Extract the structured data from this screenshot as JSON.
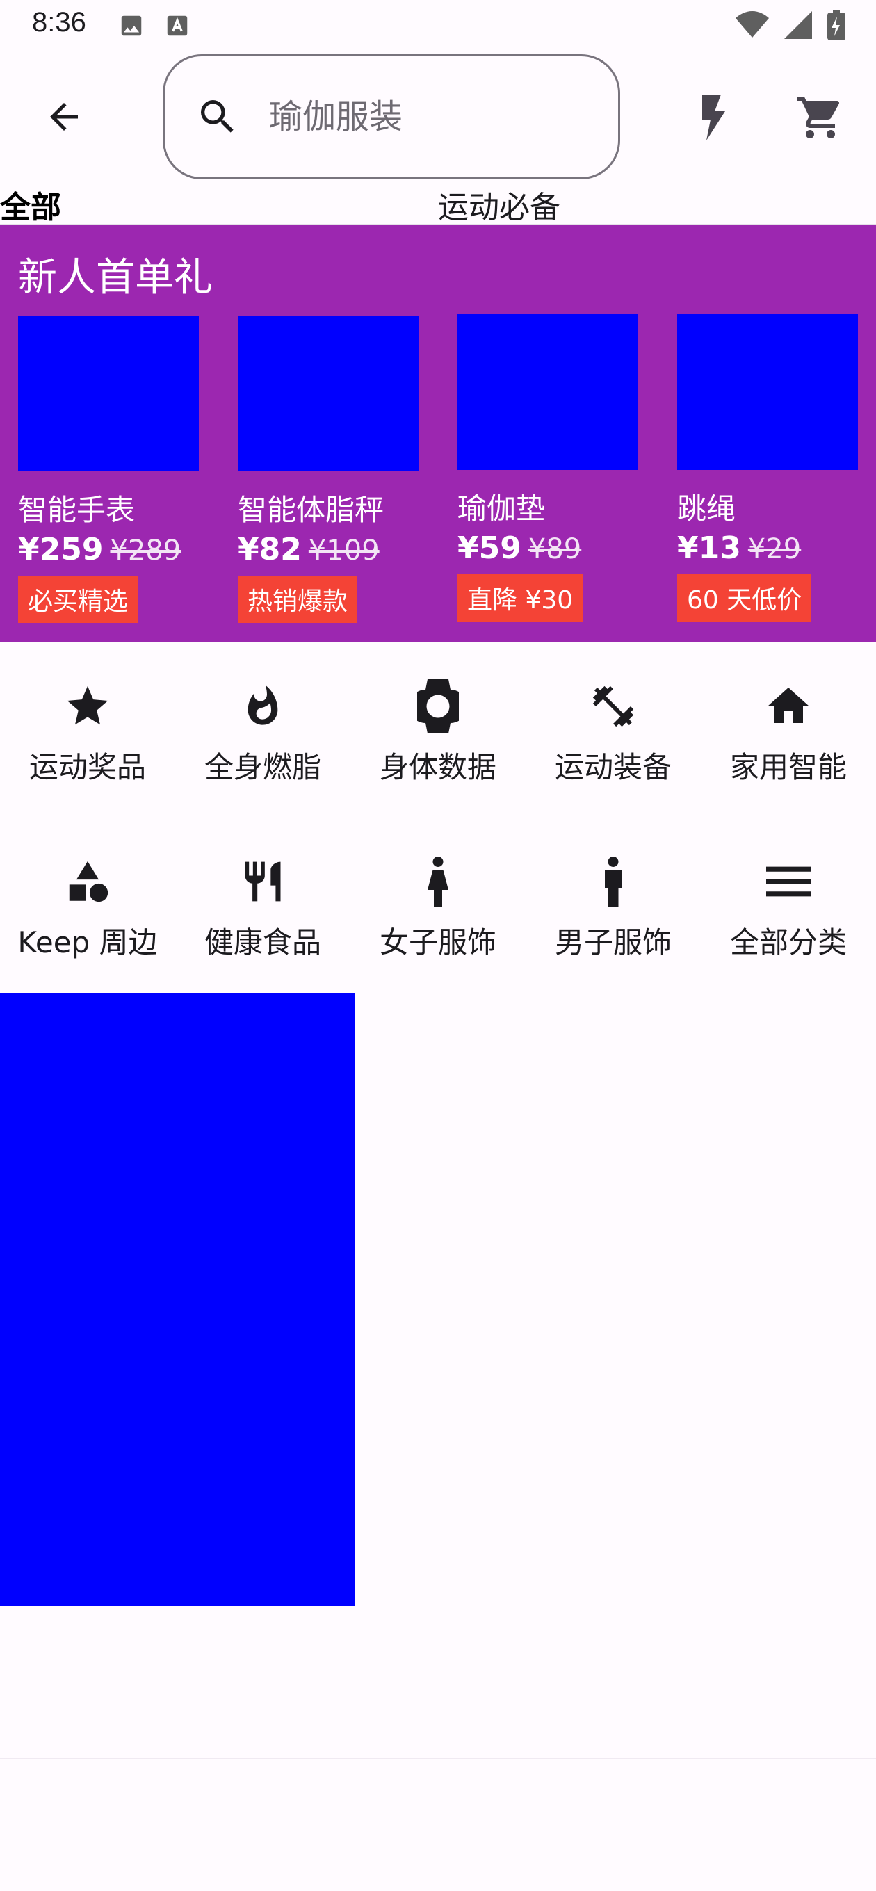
{
  "status_bar": {
    "time": "8:36"
  },
  "search": {
    "placeholder": "瑜伽服装"
  },
  "tabs": [
    {
      "label": "全部"
    },
    {
      "label": "运动必备"
    }
  ],
  "promo": {
    "title": "新人首单礼",
    "background": "#9C27B0",
    "products": [
      {
        "name": "智能手表",
        "price": "¥259",
        "original_price": "¥289",
        "tag": "必买精选"
      },
      {
        "name": "智能体脂秤",
        "price": "¥82",
        "original_price": "¥109",
        "tag": "热销爆款"
      },
      {
        "name": "瑜伽垫",
        "price": "¥59",
        "original_price": "¥89",
        "tag": "直降 ¥30"
      },
      {
        "name": "跳绳",
        "price": "¥13",
        "original_price": "¥29",
        "tag": "60 天低价"
      }
    ]
  },
  "categories": [
    {
      "label": "运动奖品",
      "icon": "star-icon"
    },
    {
      "label": "全身燃脂",
      "icon": "flame-icon"
    },
    {
      "label": "身体数据",
      "icon": "watch-icon"
    },
    {
      "label": "运动装备",
      "icon": "dumbbell-icon"
    },
    {
      "label": "家用智能",
      "icon": "home-icon"
    },
    {
      "label": "Keep 周边",
      "icon": "shapes-icon"
    },
    {
      "label": "健康食品",
      "icon": "restaurant-icon"
    },
    {
      "label": "女子服饰",
      "icon": "woman-icon"
    },
    {
      "label": "男子服饰",
      "icon": "man-icon"
    },
    {
      "label": "全部分类",
      "icon": "menu-icon"
    }
  ],
  "colors": {
    "accent": "#9C27B0",
    "tag": "#F44336",
    "placeholder_image": "#0000FF"
  }
}
